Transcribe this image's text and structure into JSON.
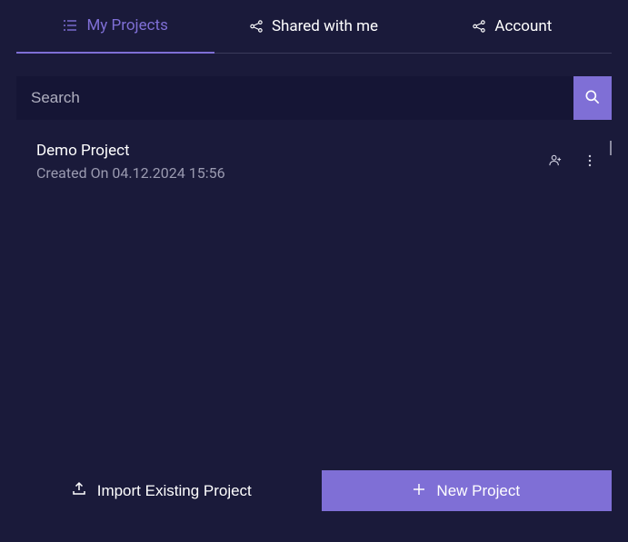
{
  "tabs": {
    "my_projects": "My Projects",
    "shared": "Shared with me",
    "account": "Account"
  },
  "search": {
    "placeholder": "Search"
  },
  "projects": [
    {
      "title": "Demo Project",
      "created": "Created On 04.12.2024 15:56"
    }
  ],
  "buttons": {
    "import": "Import Existing Project",
    "new": "New Project"
  }
}
